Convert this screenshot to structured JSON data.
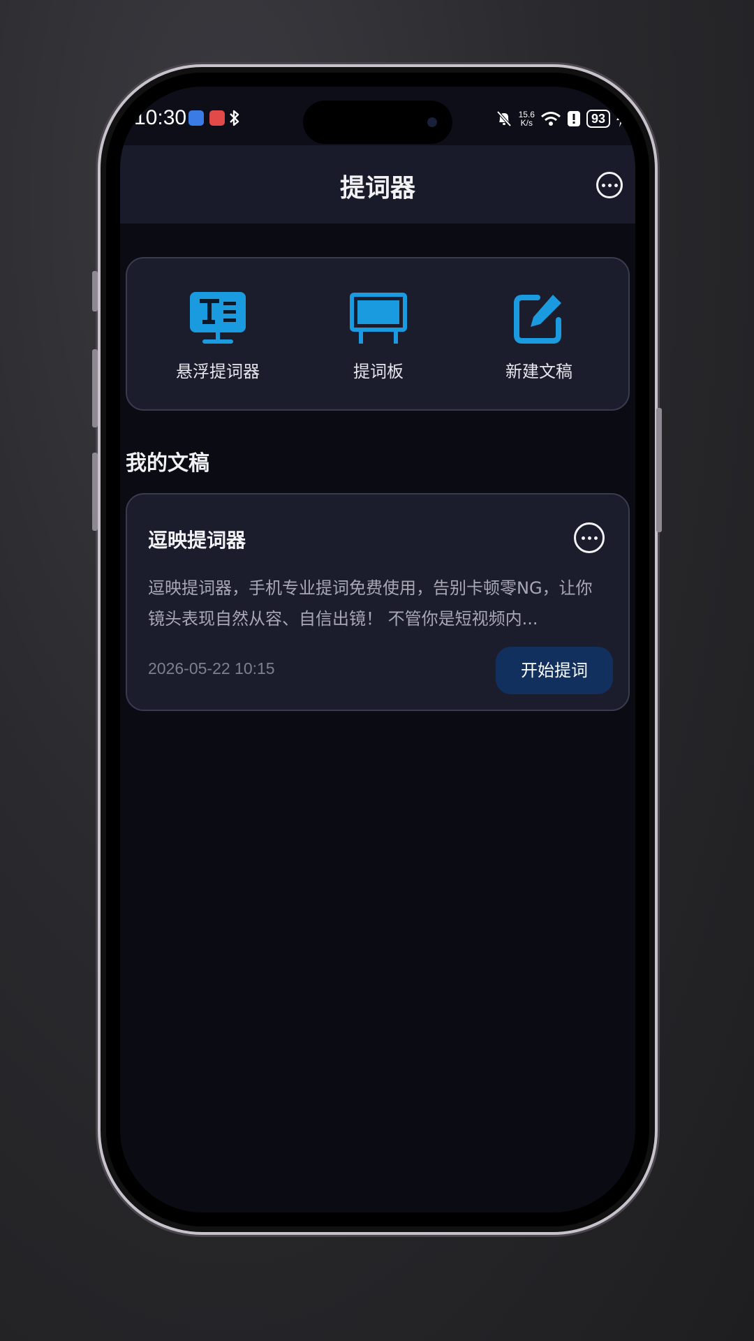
{
  "status_bar": {
    "time": "10:30",
    "net_speed_value": "15.6",
    "net_speed_unit": "K/s",
    "battery": "93",
    "icons": [
      "usb-debug-icon",
      "huawei-app-icon",
      "bluetooth-icon",
      "mute-bell-icon",
      "wifi-icon",
      "alert-icon",
      "charging-icon"
    ]
  },
  "header": {
    "title": "提词器",
    "more_icon": "more-dots-icon"
  },
  "tools": [
    {
      "label": "悬浮提词器",
      "icon": "floating-teleprompter-icon"
    },
    {
      "label": "提词板",
      "icon": "prompt-board-icon"
    },
    {
      "label": "新建文稿",
      "icon": "new-document-icon"
    }
  ],
  "section": {
    "title": "我的文稿"
  },
  "documents": [
    {
      "title": "逗映提词器",
      "excerpt": "逗映提词器，手机专业提词免费使用，告别卡顿零NG，让你镜头表现自然从容、自信出镜！ 不管你是短视频内...",
      "date": "2026-05-22 10:15",
      "action_label": "开始提词"
    }
  ],
  "colors": {
    "accent": "#1a9be0",
    "button_bg": "#12305e",
    "card_bg": "#1b1c2c",
    "background": "#0a0b13"
  }
}
